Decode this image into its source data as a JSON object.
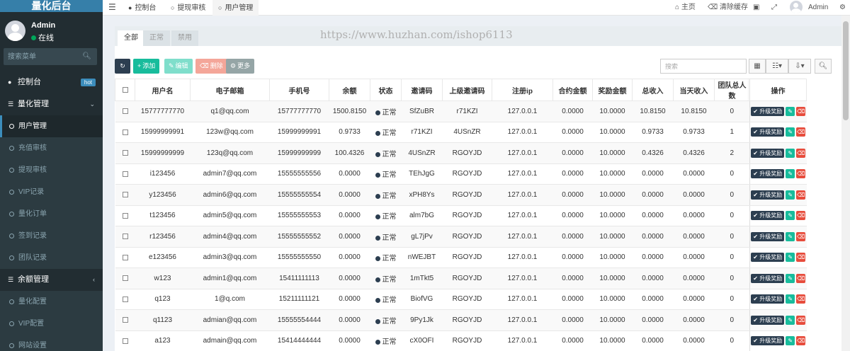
{
  "sidebar": {
    "brand": "量化后台",
    "user_name": "Admin",
    "user_status": "在线",
    "search_placeholder": "搜索菜单",
    "menu": {
      "dashboard": "控制台",
      "dashboard_badge": "hot",
      "quant_manage": "量化管理",
      "sub": [
        "用户管理",
        "充值审核",
        "提现审核",
        "VIP记录",
        "量化订单",
        "签到记录",
        "团队记录"
      ],
      "balance_manage": "余额管理",
      "sub2": [
        "量化配置",
        "VIP配置",
        "网站设置"
      ]
    }
  },
  "topbar": {
    "tabs": [
      "控制台",
      "提现审核",
      "用户管理"
    ],
    "home": "主页",
    "clear_cache": "清除缓存",
    "admin": "Admin"
  },
  "panel": {
    "tabs": [
      "全部",
      "正常",
      "禁用"
    ],
    "watermark": "https://www.huzhan.com/ishop6113"
  },
  "toolbar": {
    "add": "添加",
    "edit": "编辑",
    "delete": "删除",
    "more": "更多",
    "search_placeholder": "搜索"
  },
  "table": {
    "headers": [
      "用户名",
      "电子邮箱",
      "手机号",
      "余额",
      "状态",
      "邀请码",
      "上级邀请码",
      "注册ip",
      "合约金额",
      "奖励金额",
      "总收入",
      "当天收入",
      "团队总人数",
      "操作"
    ],
    "upgrade_label": "升级奖励",
    "rows": [
      [
        "15777777770",
        "q1@qq.com",
        "15777777770",
        "1500.8150",
        "正常",
        "SfZuBR",
        "r71KZI",
        "127.0.0.1",
        "0.0000",
        "10.0000",
        "10.8150",
        "10.8150",
        "0"
      ],
      [
        "15999999991",
        "123w@qq.com",
        "15999999991",
        "0.9733",
        "正常",
        "r71KZI",
        "4USnZR",
        "127.0.0.1",
        "0.0000",
        "10.0000",
        "0.9733",
        "0.9733",
        "1"
      ],
      [
        "15999999999",
        "123q@qq.com",
        "15999999999",
        "100.4326",
        "正常",
        "4USnZR",
        "RGOYJD",
        "127.0.0.1",
        "0.0000",
        "10.0000",
        "0.4326",
        "0.4326",
        "2"
      ],
      [
        "i123456",
        "admin7@qq.com",
        "15555555556",
        "0.0000",
        "正常",
        "TEhJgG",
        "RGOYJD",
        "127.0.0.1",
        "0.0000",
        "10.0000",
        "0.0000",
        "0.0000",
        "0"
      ],
      [
        "y123456",
        "admin6@qq.com",
        "15555555554",
        "0.0000",
        "正常",
        "xPH8Ys",
        "RGOYJD",
        "127.0.0.1",
        "0.0000",
        "10.0000",
        "0.0000",
        "0.0000",
        "0"
      ],
      [
        "t123456",
        "admin5@qq.com",
        "15555555553",
        "0.0000",
        "正常",
        "alm7bG",
        "RGOYJD",
        "127.0.0.1",
        "0.0000",
        "10.0000",
        "0.0000",
        "0.0000",
        "0"
      ],
      [
        "r123456",
        "admin4@qq.com",
        "15555555552",
        "0.0000",
        "正常",
        "gL7jPv",
        "RGOYJD",
        "127.0.0.1",
        "0.0000",
        "10.0000",
        "0.0000",
        "0.0000",
        "0"
      ],
      [
        "e123456",
        "admin3@qq.com",
        "15555555550",
        "0.0000",
        "正常",
        "nWEJBT",
        "RGOYJD",
        "127.0.0.1",
        "0.0000",
        "10.0000",
        "0.0000",
        "0.0000",
        "0"
      ],
      [
        "w123",
        "admin1@qq.com",
        "15411111113",
        "0.0000",
        "正常",
        "1mTkt5",
        "RGOYJD",
        "127.0.0.1",
        "0.0000",
        "10.0000",
        "0.0000",
        "0.0000",
        "0"
      ],
      [
        "q123",
        "1@q.com",
        "15211111121",
        "0.0000",
        "正常",
        "BiofVG",
        "RGOYJD",
        "127.0.0.1",
        "0.0000",
        "10.0000",
        "0.0000",
        "0.0000",
        "0"
      ],
      [
        "q1123",
        "admian@qq.com",
        "15555554444",
        "0.0000",
        "正常",
        "9Py1Jk",
        "RGOYJD",
        "127.0.0.1",
        "0.0000",
        "10.0000",
        "0.0000",
        "0.0000",
        "0"
      ],
      [
        "a123",
        "admain@qq.com",
        "15414444444",
        "0.0000",
        "正常",
        "cX0OFI",
        "RGOYJD",
        "127.0.0.1",
        "0.0000",
        "10.0000",
        "0.0000",
        "0.0000",
        "0"
      ]
    ]
  }
}
